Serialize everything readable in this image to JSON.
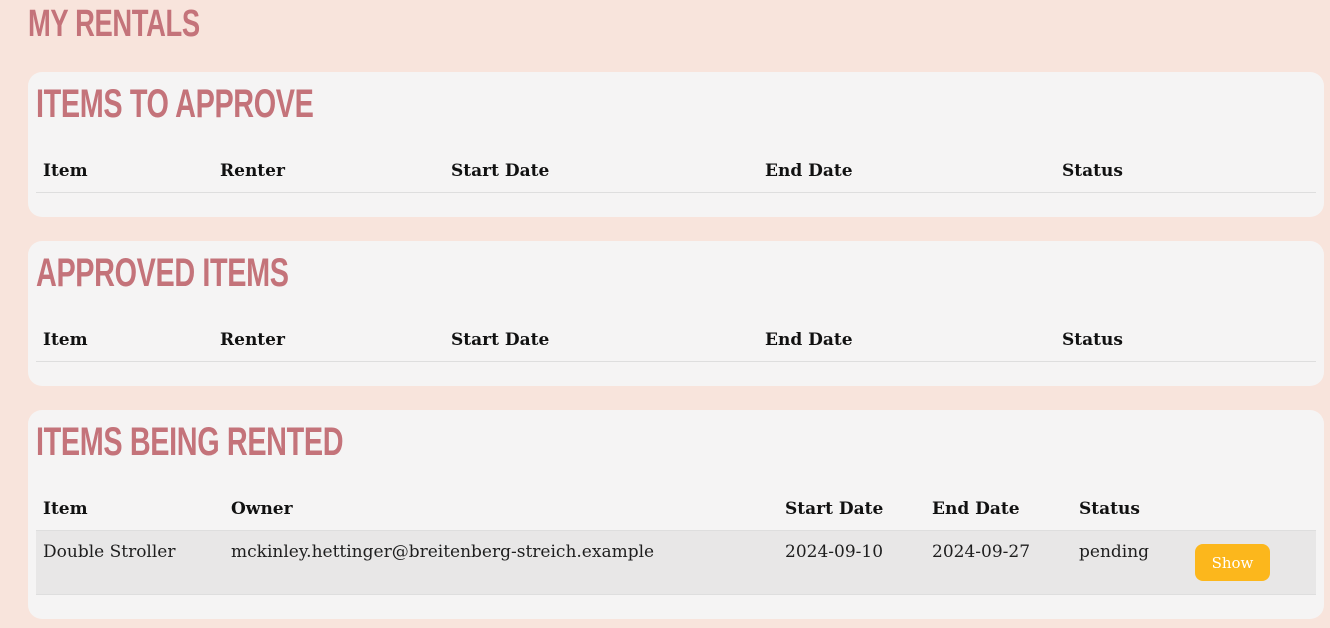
{
  "page": {
    "title": "My Rentals"
  },
  "sections": {
    "to_approve": {
      "title": "Items to Approve",
      "columns": [
        "Item",
        "Renter",
        "Start Date",
        "End Date",
        "Status"
      ]
    },
    "approved": {
      "title": "Approved Items",
      "columns": [
        "Item",
        "Renter",
        "Start Date",
        "End Date",
        "Status"
      ]
    },
    "being_rented": {
      "title": "Items Being Rented",
      "columns": [
        "Item",
        "Owner",
        "Start Date",
        "End Date",
        "Status"
      ],
      "rows": [
        {
          "item": "Double Stroller",
          "owner": "mckinley.hettinger@breitenberg-streich.example",
          "start_date": "2024-09-10",
          "end_date": "2024-09-27",
          "status": "pending",
          "action_label": "Show"
        }
      ]
    }
  },
  "colors": {
    "page_background": "#f8e4dc",
    "card_background": "#f5f4f4",
    "heading": "#c4737a",
    "button": "#fcb71c"
  }
}
